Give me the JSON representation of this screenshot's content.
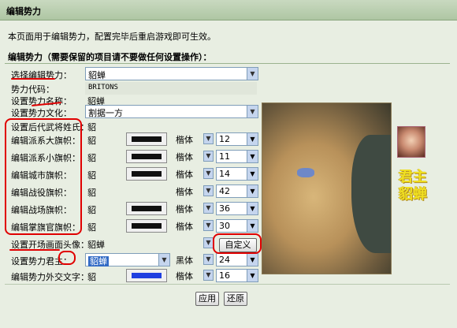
{
  "window": {
    "title": "编辑势力"
  },
  "description": "本页面用于编辑势力，配置完毕后重启游戏即可生效。",
  "section_title": "编辑势力（需要保留的项目请不要做任何设置操作）：",
  "form": {
    "select_force": {
      "label": "选择编辑势力：",
      "value": "貂蝉"
    },
    "force_code": {
      "label": "势力代码：",
      "value": "BRITONS"
    },
    "force_name": {
      "label": "设置势力名称：",
      "value": "貂蝉"
    },
    "force_culture": {
      "label": "设置势力文化：",
      "value": "割据一方"
    },
    "heir_surname": {
      "label": "设置后代武将姓氏：",
      "value": "貂"
    },
    "flag_rows": [
      {
        "label": "编辑派系大旗帜：",
        "char": "貂",
        "color": "#111111",
        "font": "楷体",
        "size": "12"
      },
      {
        "label": "编辑派系小旗帜：",
        "char": "貂",
        "color": "#111111",
        "font": "楷体",
        "size": "11"
      },
      {
        "label": "编辑城市旗帜：",
        "char": "貂",
        "color": "#111111",
        "font": "楷体",
        "size": "14"
      },
      {
        "label": "编辑战役旗帜：",
        "char": "貂",
        "color": "#111111",
        "font": "楷体",
        "size": "42"
      },
      {
        "label": "编辑战场旗帜：",
        "char": "貂",
        "color": "#111111",
        "font": "楷体",
        "size": "36"
      },
      {
        "label": "编辑掌旗官旗帜：",
        "char": "貂",
        "color": "#111111",
        "font": "楷体",
        "size": "30"
      }
    ],
    "opening_portrait": {
      "label": "设置开场画面头像：",
      "value": "貂蝉",
      "button": "自定义"
    },
    "ruler": {
      "label": "设置势力君主：",
      "value": "貂蝉",
      "font": "黑体",
      "size": "24"
    },
    "diplomacy_text": {
      "label": "编辑势力外交文字：",
      "char": "貂",
      "color": "#1f3fe0",
      "font": "楷体",
      "size": "16"
    }
  },
  "preview": {
    "caption_line1": "君主",
    "caption_line2": "貂蝉"
  },
  "buttons": {
    "apply": "应用",
    "reset": "还原"
  },
  "icons": {
    "dropdown": "chevron-down-icon",
    "map": "map-preview",
    "portrait": "portrait-image"
  },
  "colors": {
    "annotation": "#e00000",
    "header_bg": "#b7cdad",
    "page_bg": "#e8eee2"
  }
}
